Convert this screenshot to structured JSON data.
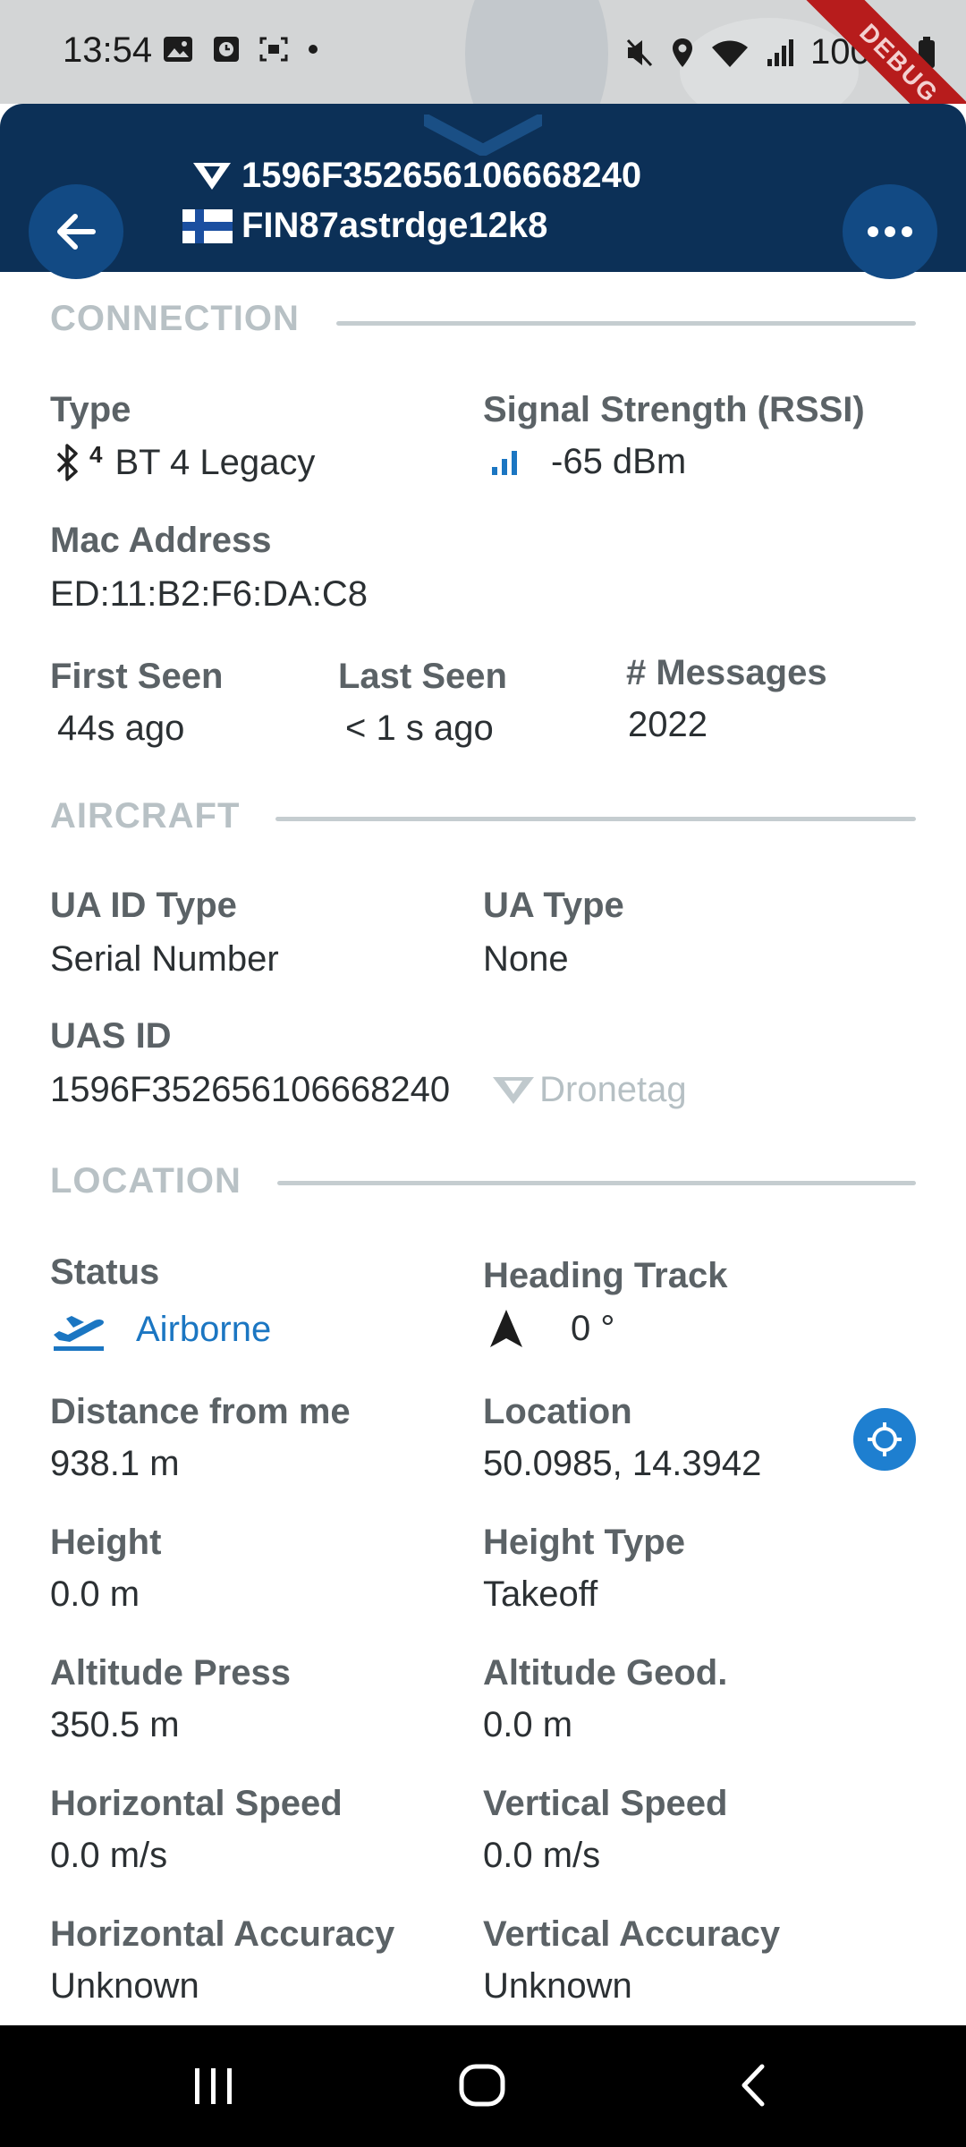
{
  "status_bar": {
    "time": "13:54",
    "battery": "100%",
    "debug_label": "DEBUG",
    "left_icons": [
      "image-icon",
      "clock-badge-icon",
      "screenshot-icon",
      "dot-icon"
    ],
    "right_icons": [
      "mute-icon",
      "location-icon",
      "wifi-icon",
      "signal-icon",
      "battery-icon"
    ]
  },
  "header": {
    "uas_id": "1596F352656106668240",
    "operator_id": "FIN87astrdge12k8",
    "country_flag": "finland-flag"
  },
  "connection": {
    "title": "CONNECTION",
    "type_label": "Type",
    "type_value": "BT 4 Legacy",
    "type_badge": "4",
    "rssi_label": "Signal Strength (RSSI)",
    "rssi_value": "-65 dBm",
    "mac_label": "Mac Address",
    "mac_value": "ED:11:B2:F6:DA:C8",
    "first_seen_label": "First Seen",
    "first_seen_value": "44s ago",
    "last_seen_label": "Last Seen",
    "last_seen_value": "< 1 s ago",
    "messages_label": "# Messages",
    "messages_value": "2022"
  },
  "aircraft": {
    "title": "AIRCRAFT",
    "ua_id_type_label": "UA ID Type",
    "ua_id_type_value": "Serial Number",
    "ua_type_label": "UA Type",
    "ua_type_value": "None",
    "uas_id_label": "UAS ID",
    "uas_id_value": "1596F352656106668240",
    "manufacturer": "Dronetag"
  },
  "location": {
    "title": "LOCATION",
    "status_label": "Status",
    "status_value": "Airborne",
    "heading_label": "Heading Track",
    "heading_value": "0 °",
    "distance_label": "Distance from me",
    "distance_value": "938.1 m",
    "location_label": "Location",
    "location_value": "50.0985, 14.3942",
    "height_label": "Height",
    "height_value": "0.0 m",
    "height_type_label": "Height Type",
    "height_type_value": "Takeoff",
    "alt_press_label": "Altitude Press",
    "alt_press_value": "350.5 m",
    "alt_geod_label": "Altitude Geod.",
    "alt_geod_value": "0.0 m",
    "h_speed_label": "Horizontal Speed",
    "h_speed_value": "0.0 m/s",
    "v_speed_label": "Vertical Speed",
    "v_speed_value": "0.0 m/s",
    "h_acc_label": "Horizontal Accuracy",
    "h_acc_value": "Unknown",
    "v_acc_label": "Vertical Accuracy",
    "v_acc_value": "Unknown"
  },
  "colors": {
    "header_bg": "#0c3057",
    "button_bg": "#124a84",
    "accent_blue": "#1b76c2",
    "label_gray": "#5b6266",
    "section_gray": "#b8c1c5"
  }
}
